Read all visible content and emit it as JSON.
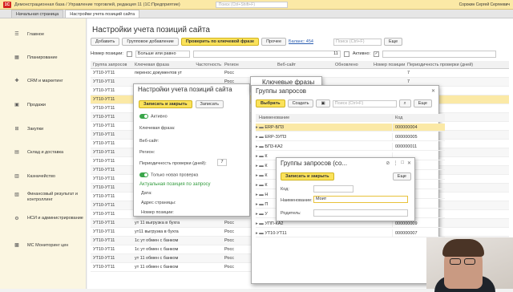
{
  "topbar": {
    "title": "Демонстрационная база / Управление торговлей, редакция 11  (1С:Предприятие)",
    "search_placeholder": "Поиск (Ctrl+Shift+F)",
    "user": "Сорокин Сергей Сергеевич"
  },
  "tabs": [
    "Начальная страница",
    "Настройки учета позиций сайта"
  ],
  "sidebar": [
    {
      "icon": "menu-icon",
      "label": "Главное"
    },
    {
      "icon": "chart-icon",
      "label": "Планирование"
    },
    {
      "icon": "crm-icon",
      "label": "CRM и маркетинг"
    },
    {
      "icon": "sales-icon",
      "label": "Продажи"
    },
    {
      "icon": "cart-icon",
      "label": "Закупки"
    },
    {
      "icon": "warehouse-icon",
      "label": "Склад и доставка"
    },
    {
      "icon": "money-icon",
      "label": "Казначейство"
    },
    {
      "icon": "finance-icon",
      "label": "Финансовый результат и контроллинг"
    },
    {
      "icon": "nsi-icon",
      "label": "НСИ и администрирование"
    },
    {
      "icon": "monitor-icon",
      "label": "МС Мониторинг цен"
    }
  ],
  "main": {
    "title": "Настройки учета позиций сайта",
    "toolbar": {
      "add": "Добавить",
      "group_add": "Групповое добавление",
      "check_by_phrase": "Проверить по ключевой фразе",
      "other": "Прочее",
      "balance": "Баланс: 454",
      "search_placeholder": "Поиск (Ctrl+F)",
      "more": "Еще"
    },
    "filter": {
      "position_number": "Номер позиции:",
      "condition": "Больше или равно",
      "value": "11",
      "active": "Активно:"
    },
    "columns": [
      "Группа запросов",
      "Ключевая фраза",
      "Частотность",
      "Регион",
      "Веб-сайт",
      "Обновлено",
      "Номер позиции",
      "Периодичность проверки (дней)"
    ],
    "rows": [
      [
        "УТ10-УТ11",
        "перенос документов ут",
        "",
        "Росс",
        "",
        "",
        "",
        "7"
      ],
      [
        "УТ10-УТ11",
        "",
        "",
        "Росс",
        "",
        "",
        "",
        "7"
      ],
      [
        "УТ10-УТ11",
        "",
        "",
        "Росс",
        "",
        "",
        "",
        "7"
      ],
      [
        "УТ10-УТ11",
        "",
        "",
        "Росс",
        "",
        "",
        "",
        "7"
      ],
      [
        "УТ10-УТ11",
        "",
        "",
        "Росс",
        "",
        "",
        "",
        "7"
      ],
      [
        "УТ10-УТ11",
        "",
        "",
        "Росс",
        "",
        "",
        "",
        "7"
      ],
      [
        "УТ10-УТ11",
        "",
        "",
        "Росс",
        "",
        "",
        "",
        "7"
      ],
      [
        "УТ10-УТ11",
        "",
        "",
        "Росс",
        "",
        "",
        "",
        "7"
      ],
      [
        "УТ10-УТ11",
        "",
        "",
        "Росс",
        "",
        "",
        "",
        "7"
      ],
      [
        "УТ10-УТ11",
        "",
        "",
        "Росс",
        "",
        "",
        "",
        "7"
      ],
      [
        "УТ10-УТ11",
        "",
        "",
        "Росс",
        "",
        "",
        "",
        "7"
      ],
      [
        "УТ10-УТ11",
        "",
        "",
        "Росс",
        "",
        "",
        "",
        "7"
      ],
      [
        "УТ10-УТ11",
        "",
        "",
        "Росс",
        "",
        "",
        "",
        "7"
      ],
      [
        "УТ10-УТ11",
        "",
        "",
        "Росс",
        "",
        "",
        "",
        "7"
      ],
      [
        "УТ10-УТ11",
        "",
        "",
        "Росс",
        "",
        "",
        "",
        "7"
      ],
      [
        "УТ10-УТ11",
        "обмен данными между",
        "",
        "Росс",
        "",
        "",
        "",
        "7"
      ],
      [
        "УТ10-УТ11",
        "ут 11 выгрузка в бухга",
        "",
        "Росс",
        "",
        "",
        "",
        "7"
      ],
      [
        "УТ10-УТ11",
        "ут 11 выгрузка в бухга",
        "",
        "Росс",
        "",
        "",
        "",
        "7"
      ],
      [
        "УТ10-УТ11",
        "ут11 выгрузка в бухга",
        "",
        "Росс",
        "",
        "",
        "",
        "7"
      ],
      [
        "УТ10-УТ11",
        "1с ут обмен с банком",
        "",
        "Росс",
        "",
        "",
        "",
        "7"
      ],
      [
        "УТ10-УТ11",
        "1с ут обмен с банком",
        "",
        "Росс",
        "",
        "",
        "",
        "7"
      ],
      [
        "УТ10-УТ11",
        "ут 11 обмен с банком",
        "",
        "Росс",
        "",
        "",
        "",
        "7"
      ],
      [
        "УТ10-УТ11",
        "ут 11 обмен с банком",
        "",
        "Росс",
        "",
        "",
        "",
        "7"
      ]
    ]
  },
  "settings_dialog": {
    "title": "Настройки учета позиций сайта",
    "save_close": "Записать и закрыть",
    "save": "Записать",
    "active": "Активно",
    "phrase": "Ключевая фраза:",
    "website": "Веб-сайт:",
    "region": "Регион:",
    "period": "Периодичность проверки (дней):",
    "period_value": "7",
    "only_new": "Только новая проверка",
    "actual_header": "Актуальная позиция по запросу",
    "date": "Дата:",
    "page_address": "Адрес страницы:",
    "position": "Номер позиции:"
  },
  "phrases_dialog": {
    "title": "Ключевые фразы"
  },
  "groups_dialog": {
    "title": "Группы запросов",
    "choose": "Выбрать",
    "create": "Создать",
    "search_placeholder": "Поиск (Ctrl+F)",
    "more": "Еще",
    "col_name": "Наименование",
    "col_code": "Код",
    "rows": [
      {
        "name": "ERP-БП3",
        "code": "000000004",
        "sel": true
      },
      {
        "name": "ERP-ЗУП3",
        "code": "000000005",
        "sel": false
      },
      {
        "name": "БП3-КА2",
        "code": "000000011",
        "sel": false
      },
      {
        "name": "К",
        "code": "",
        "sel": false
      },
      {
        "name": "К",
        "code": "",
        "sel": false
      },
      {
        "name": "К",
        "code": "",
        "sel": false
      },
      {
        "name": "К",
        "code": "",
        "sel": false
      },
      {
        "name": "Н",
        "code": "",
        "sel": false
      },
      {
        "name": "П",
        "code": "",
        "sel": false
      },
      {
        "name": "У",
        "code": "",
        "sel": false
      },
      {
        "name": "УПП-КА2",
        "code": "000000009",
        "sel": false
      },
      {
        "name": "УТ10-УТ11",
        "code": "000000007",
        "sel": false
      }
    ]
  },
  "new_group_dialog": {
    "title": "Группы запросов (со...",
    "save_close": "Записать и закрыть",
    "more": "Еще",
    "code": "Код:",
    "name": "Наименование:",
    "name_value": "Моит",
    "parent": "Родитель:"
  }
}
